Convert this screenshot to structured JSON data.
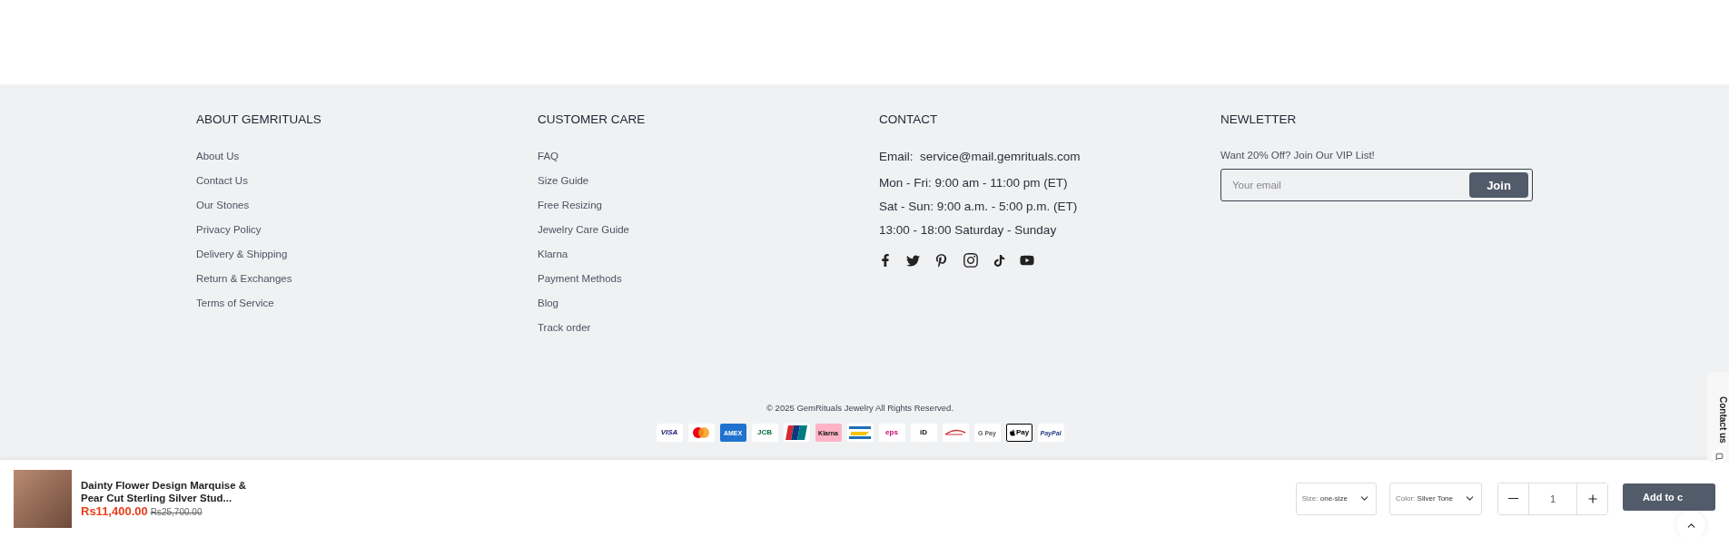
{
  "footer": {
    "columns": [
      {
        "title": "ABOUT GEMRITUALS",
        "links": [
          "About Us",
          "Contact Us",
          "Our Stones",
          "Privacy Policy",
          "Delivery & Shipping",
          "Return & Exchanges",
          "Terms of Service"
        ]
      },
      {
        "title": "CUSTOMER CARE",
        "links": [
          "FAQ",
          "Size Guide",
          "Free Resizing",
          "Jewelry Care Guide",
          "Klarna",
          "Payment Methods",
          "Blog",
          "Track order"
        ]
      }
    ],
    "contact": {
      "title": "CONTACT",
      "email_label": "Email:",
      "email": "service@mail.gemrituals.com",
      "hours": [
        "Mon - Fri: 9:00 am - 11:00 pm (ET)",
        "Sat - Sun: 9:00 a.m. - 5:00 p.m. (ET)",
        "13:00 - 18:00 Saturday - Sunday"
      ]
    },
    "newsletter": {
      "title": "NEWLETTER",
      "text": "Want 20% Off? Join Our VIP List!",
      "placeholder": "Your email",
      "button": "Join"
    },
    "copyright": "© 2025 GemRituals Jewelry All Rights Reserved.",
    "payments": [
      {
        "kind": "visa",
        "label": "VISA"
      },
      {
        "kind": "mastercard"
      },
      {
        "kind": "amex",
        "label": "AMEX"
      },
      {
        "kind": "jcb",
        "label": "JCB"
      },
      {
        "kind": "unionpay"
      },
      {
        "kind": "klarna",
        "label": "Klarna"
      },
      {
        "kind": "bancontact"
      },
      {
        "kind": "eps",
        "label": "eps"
      },
      {
        "kind": "ideal",
        "label": "iD"
      },
      {
        "kind": "przelewy"
      },
      {
        "kind": "gpay",
        "label": "G Pay"
      },
      {
        "kind": "applepay",
        "label": "Pay"
      },
      {
        "kind": "paypal",
        "label": "PayPal"
      }
    ]
  },
  "contact_tab": {
    "label": "Contact us"
  },
  "sticky_bar": {
    "title": "Dainty Flower Design Marquise & Pear Cut Sterling Silver Stud...",
    "price": "Rs11,400.00",
    "old_price": "Rs25,700.00",
    "selects": [
      {
        "label": "Size:",
        "value": "one-size"
      },
      {
        "label": "Color:",
        "value": "Silver Tone"
      }
    ],
    "quantity": "1",
    "add_button": "Add to c"
  }
}
